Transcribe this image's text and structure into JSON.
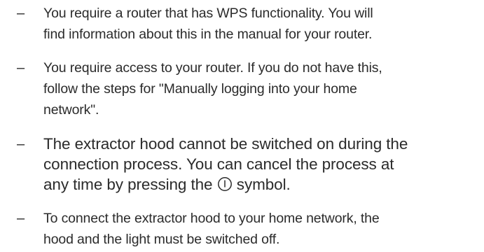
{
  "items": [
    {
      "marker": "–",
      "lines": [
        "You require a router that has WPS functionality. You will",
        "find information about this in the manual for your router."
      ]
    },
    {
      "marker": "–",
      "lines": [
        "You require access to your router. If you do not have this,",
        "follow the steps for \"Manually logging into your home",
        "network\"."
      ]
    },
    {
      "marker": "–",
      "lines": [
        "The extractor hood cannot be switched on during the",
        "connection process. You can cancel the process at",
        "any time by pressing the",
        "symbol."
      ],
      "icon": "power-symbol-icon"
    },
    {
      "marker": "–",
      "lines": [
        "To connect the extractor hood to your home network, the",
        "hood and the light must be switched off."
      ]
    }
  ]
}
